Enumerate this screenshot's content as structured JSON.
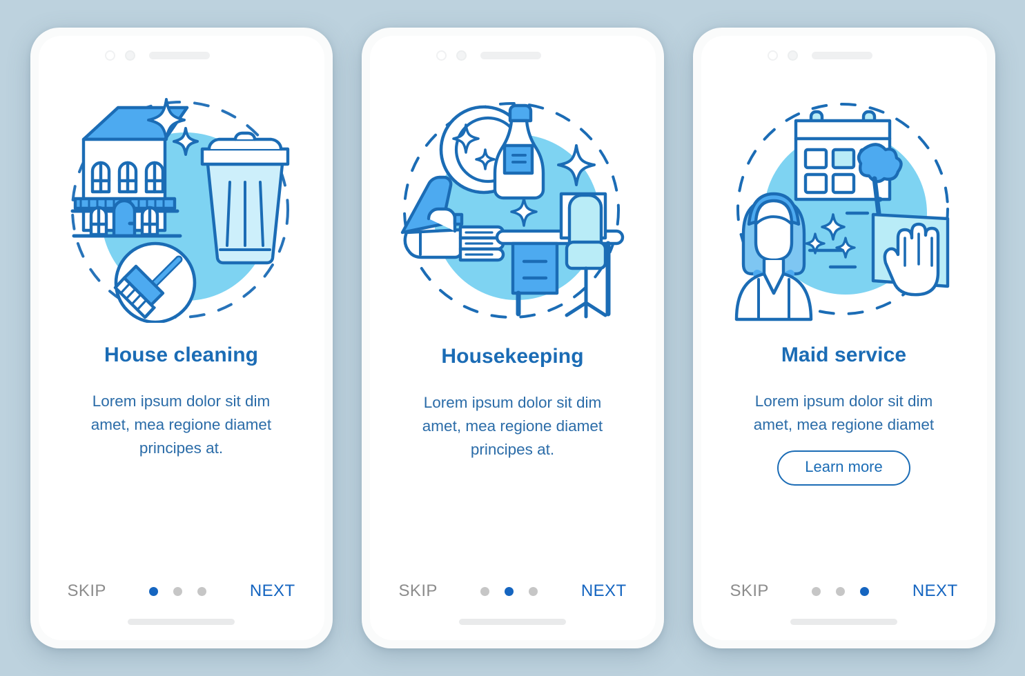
{
  "page": {
    "background_color": "#bdd2de",
    "title_color": "#1b6cb5",
    "body_color": "#2b6ca8",
    "accent_color": "#1565c0",
    "illustration_fill": "#7ed3f2",
    "illustration_stroke": "#1b6cb5",
    "inactive_dot_color": "#c6c6c6",
    "skip_color": "#8c8c8c"
  },
  "screens": [
    {
      "id": "house-cleaning",
      "title": "House cleaning",
      "description": "Lorem ipsum dolor sit dim amet, mea regione diamet principes at.",
      "illustration_name": "house-trash-broom-illustration",
      "has_learn_more": false,
      "learn_more_label": "",
      "skip_label": "SKIP",
      "next_label": "NEXT",
      "dots": [
        {
          "active": true
        },
        {
          "active": false
        },
        {
          "active": false
        }
      ],
      "active_index": 0
    },
    {
      "id": "housekeeping",
      "title": "Housekeeping",
      "description": "Lorem ipsum dolor sit dim amet, mea regione diamet principes at.",
      "illustration_name": "iron-towels-spray-desk-illustration",
      "has_learn_more": false,
      "learn_more_label": "",
      "skip_label": "SKIP",
      "next_label": "NEXT",
      "dots": [
        {
          "active": false
        },
        {
          "active": true
        },
        {
          "active": false
        }
      ],
      "active_index": 1
    },
    {
      "id": "maid-service",
      "title": "Maid service",
      "description": "Lorem ipsum dolor sit dim amet, mea regione diamet",
      "illustration_name": "maid-calendar-duster-illustration",
      "has_learn_more": true,
      "learn_more_label": "Learn more",
      "skip_label": "SKIP",
      "next_label": "NEXT",
      "dots": [
        {
          "active": false
        },
        {
          "active": false
        },
        {
          "active": true
        }
      ],
      "active_index": 2
    }
  ]
}
